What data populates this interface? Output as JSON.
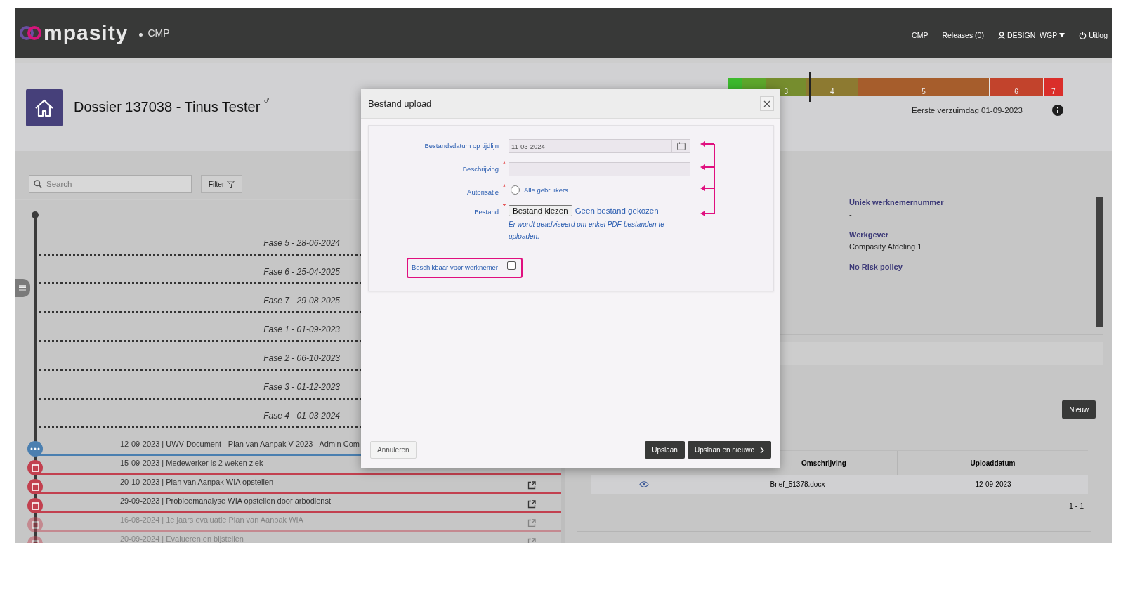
{
  "header": {
    "logo_text": "mpasity",
    "app": "CMP",
    "nav": [
      {
        "label": "CMP",
        "kind": "link"
      },
      {
        "label": "Releases (0)",
        "kind": "link"
      },
      {
        "label": "DESIGN_WGP",
        "kind": "user"
      },
      {
        "label": "Uitlog",
        "kind": "logout"
      }
    ]
  },
  "dossier": {
    "title": "Dossier 137038 - Tinus Tester",
    "symbol": "♂"
  },
  "phase_bar": {
    "level": 0.243,
    "segments": [
      {
        "color": "#3dba2e"
      },
      {
        "color": "#5ea82c"
      },
      {
        "label": "3",
        "color": "#768d2e"
      },
      {
        "label": "4",
        "color": "#8d7a31"
      },
      {
        "label": "5",
        "color": "#a65d2c"
      },
      {
        "label": "6",
        "color": "#c2432c"
      },
      {
        "label": "7",
        "color": "#da2e2a"
      }
    ]
  },
  "first_sick_day": "Eerste verzuimdag 01-09-2023",
  "search": {
    "placeholder": "Search"
  },
  "filter_button": "Filter",
  "phases": [
    "Fase 5 - 28-06-2024",
    "Fase 6 - 25-04-2025",
    "Fase 7 - 29-08-2025",
    "Fase 1 - 01-09-2023",
    "Fase 2 - 06-10-2023",
    "Fase 3 - 01-12-2023",
    "Fase 4 - 01-03-2024"
  ],
  "events": [
    {
      "text": "12-09-2023 | UWV Document - Plan van Aanpak V 2023 - Admin Com",
      "kind": "document",
      "faded": false,
      "has_link": false
    },
    {
      "text": "15-09-2023 | Medewerker is 2 weken ziek",
      "kind": "task",
      "faded": false,
      "has_link": false
    },
    {
      "text": "20-10-2023 | Plan van Aanpak WIA opstellen",
      "kind": "task",
      "faded": false,
      "has_link": true
    },
    {
      "text": "29-09-2023 | Probleemanalyse WIA opstellen door arbodienst",
      "kind": "task",
      "faded": false,
      "has_link": true
    },
    {
      "text": "16-08-2024 | 1e jaars evaluatie Plan van Aanpak WIA",
      "kind": "task",
      "faded": true,
      "has_link": true
    },
    {
      "text": "20-09-2024 | Evalueren en bijstellen",
      "kind": "task",
      "faded": true,
      "has_link": true
    }
  ],
  "details": [
    {
      "label": "Uniek werknemernummer",
      "value": "-"
    },
    {
      "label": "Werkgever",
      "value": "Compasity Afdeling 1"
    },
    {
      "label": "No Risk policy",
      "value": "-"
    }
  ],
  "new_button": "Nieuw",
  "table": {
    "columns": [
      "Omschrijving",
      "Uploaddatum"
    ],
    "rows": [
      {
        "description": "Brief_51378.docx",
        "date": "12-09-2023"
      }
    ],
    "pagination": "1 - 1"
  },
  "modal": {
    "title": "Bestand upload",
    "fields": [
      {
        "kind": "date",
        "label": "Bestandsdatum op tijdlijn",
        "value": "11-03-2024"
      },
      {
        "kind": "text",
        "label": "Beschrijving",
        "required_mark": "*"
      },
      {
        "kind": "radio",
        "label": "Autorisatie",
        "required_mark": "*",
        "option": "Alle gebruikers",
        "selected": false
      },
      {
        "kind": "file",
        "label": "Bestand",
        "required_mark": "*",
        "button": "Bestand kiezen",
        "status": "Geen bestand gekozen",
        "hint": "Er wordt geadviseerd om enkel PDF-bestanden te uploaden."
      }
    ],
    "checkbox": {
      "label": "Beschikbaar voor werknemer",
      "checked": false
    },
    "buttons": [
      {
        "label": "Annuleren",
        "kind": "secondary"
      },
      {
        "label": "Upslaan",
        "kind": "primary"
      },
      {
        "label": "Upslaan en nieuwe",
        "kind": "primary_next"
      }
    ]
  }
}
